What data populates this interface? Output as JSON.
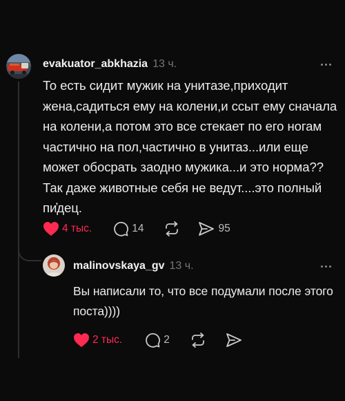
{
  "post": {
    "username": "evakuator_abkhazia",
    "time": "13 ч.",
    "text": "То есть сидит мужик на унитазе,приходит жена,садиться ему на колени,и ссыт ему сначала на колени,а потом это все стекает по его ногам частично на пол,частично в унитаз...или еще может обосрать заодно мужика...и это норма??Так даже животные себя не ведут....это полный пи҆дец.",
    "likes": "4 тыс.",
    "comments": "14",
    "shares": "95",
    "more_icon": "more-icon"
  },
  "reply": {
    "username": "malinovskaya_gv",
    "time": "13 ч.",
    "text": "Вы написали то, что все подумали после этого поста))))",
    "likes": "2 тыс.",
    "comments": "2",
    "more_icon": "more-icon"
  },
  "colors": {
    "background": "#0b0b0b",
    "like_red": "#ff2a51",
    "muted": "#777777"
  }
}
